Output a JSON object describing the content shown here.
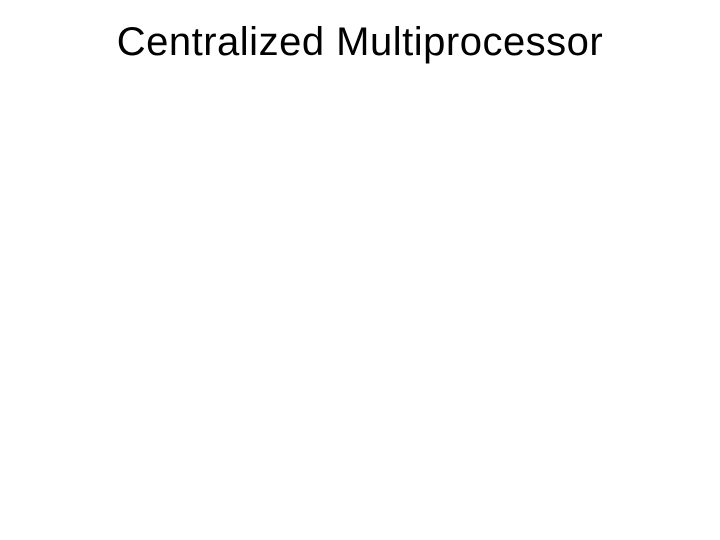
{
  "slide": {
    "title": "Centralized Multiprocessor"
  }
}
